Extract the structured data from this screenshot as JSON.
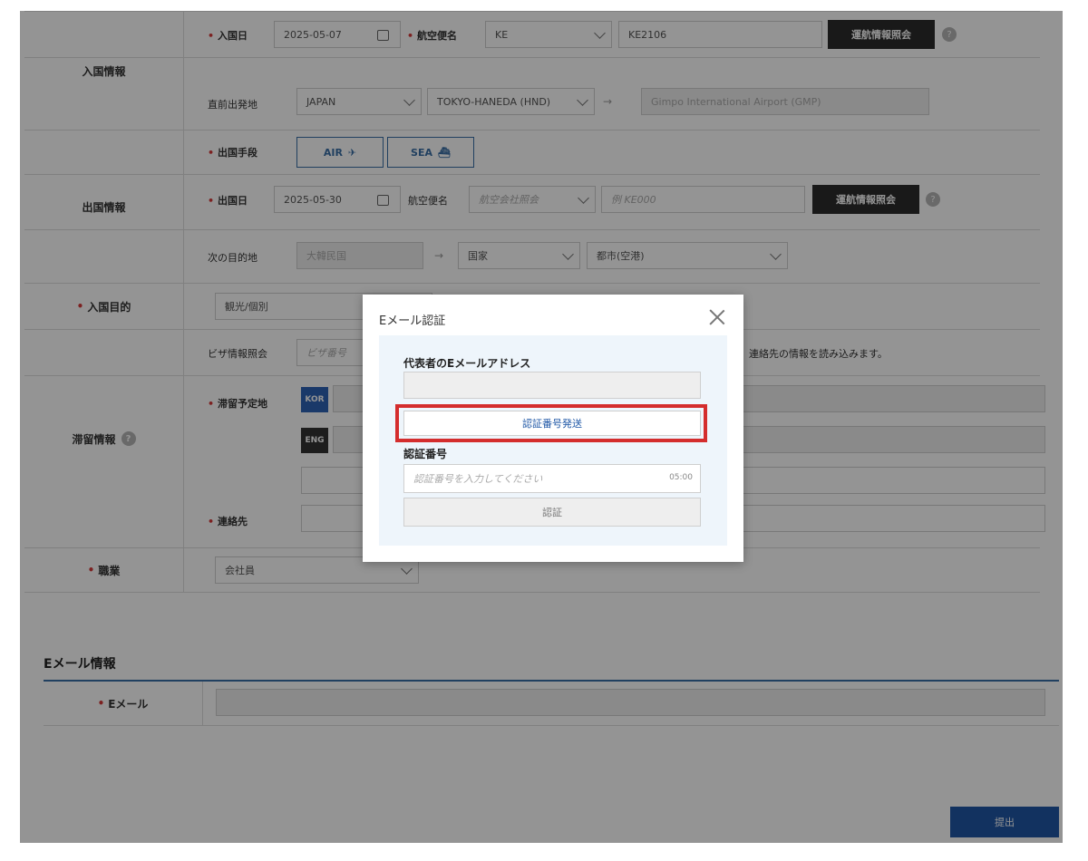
{
  "entry_info": {
    "section_label": "入国情報",
    "arrival_date_label": "入国日",
    "arrival_date": "2025-05-07",
    "flight_label": "航空便名",
    "airline": "KE",
    "flight_no": "KE2106",
    "flight_lookup_btn": "運航情報照会",
    "departure_origin_label": "直前出発地",
    "origin_country": "JAPAN",
    "origin_city": "TOKYO-HANEDA (HND)",
    "arrow": "→",
    "destination_airport": "Gimpo International Airport (GMP)"
  },
  "exit_info": {
    "section_label": "出国情報",
    "means_label": "出国手段",
    "air_label": "AIR",
    "sea_label": "SEA",
    "exit_date_label": "出国日",
    "exit_date": "2025-05-30",
    "flight_label": "航空便名",
    "airline_placeholder": "航空会社照会",
    "flight_placeholder": "例 KE000",
    "flight_lookup_btn": "運航情報照会",
    "next_dest_label": "次の目的地",
    "next_origin": "大韓民国",
    "arrow": "→",
    "country_placeholder": "国家",
    "city_placeholder": "都市(空港)"
  },
  "purpose": {
    "label": "入国目的",
    "value": "観光/個別"
  },
  "stay_info": {
    "section_label": "滞留情報",
    "visa_label": "ビザ情報照会",
    "visa_placeholder": "ビザ番号",
    "visa_note": "、連絡先の情報を読み込みます。",
    "address_label": "滞留予定地",
    "lang_kor": "KOR",
    "lang_eng": "ENG",
    "contact_label": "連絡先"
  },
  "occupation": {
    "label": "職業",
    "value": "会社員"
  },
  "email_section": {
    "title": "Eメール情報",
    "email_label": "Eメール"
  },
  "submit_label": "提出",
  "modal": {
    "title": "Eメール認証",
    "rep_email_label": "代表者のEメールアドレス",
    "send_code_btn": "認証番号発送",
    "code_label": "認証番号",
    "code_placeholder": "認証番号を入力してください",
    "timer": "05:00",
    "verify_btn": "認証"
  },
  "colors": {
    "accent_blue": "#3a6ea5",
    "highlight_red": "#d42d2d",
    "submit_blue": "#1f57a6"
  }
}
